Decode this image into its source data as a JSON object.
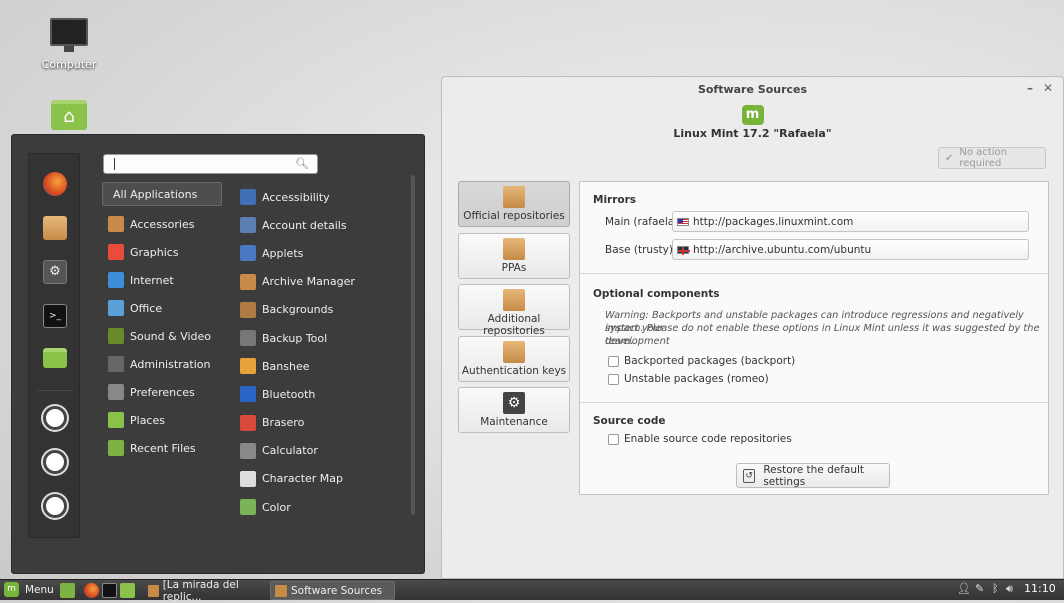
{
  "desktop": {
    "icons": [
      {
        "label": "Computer"
      },
      {
        "label": ""
      }
    ]
  },
  "menu": {
    "search_value": "",
    "categories": [
      {
        "label": "All Applications",
        "color": "#4e4e4e"
      },
      {
        "label": "Accessories",
        "color": "#c98b4a"
      },
      {
        "label": "Graphics",
        "color": "#e94c3c"
      },
      {
        "label": "Internet",
        "color": "#3c8ed6"
      },
      {
        "label": "Office",
        "color": "#5aa0d8"
      },
      {
        "label": "Sound & Video",
        "color": "#6a8a2a"
      },
      {
        "label": "Administration",
        "color": "#666666"
      },
      {
        "label": "Preferences",
        "color": "#888888"
      },
      {
        "label": "Places",
        "color": "#8bc34a"
      },
      {
        "label": "Recent Files",
        "color": "#7cb342"
      }
    ],
    "apps": [
      {
        "label": "Accessibility",
        "color": "#3f6fb5"
      },
      {
        "label": "Account details",
        "color": "#5b7fb0"
      },
      {
        "label": "Applets",
        "color": "#4a78c2"
      },
      {
        "label": "Archive Manager",
        "color": "#c98b4a"
      },
      {
        "label": "Backgrounds",
        "color": "#b07a46"
      },
      {
        "label": "Backup Tool",
        "color": "#777777"
      },
      {
        "label": "Banshee",
        "color": "#e8a23c"
      },
      {
        "label": "Bluetooth",
        "color": "#2a66c8"
      },
      {
        "label": "Brasero",
        "color": "#d94a3a"
      },
      {
        "label": "Calculator",
        "color": "#888888"
      },
      {
        "label": "Character Map",
        "color": "#dddddd"
      },
      {
        "label": "Color",
        "color": "#7ab35a"
      }
    ]
  },
  "window": {
    "title": "Software Sources",
    "brand": "Linux Mint 17.2 \"Rafaela\"",
    "no_action": "No action required",
    "tabs": [
      {
        "label": "Official repositories"
      },
      {
        "label": "PPAs"
      },
      {
        "label": "Additional repositories"
      },
      {
        "label": "Authentication keys"
      },
      {
        "label": "Maintenance"
      }
    ],
    "mirrors": {
      "title": "Mirrors",
      "main_label": "Main (rafaela)",
      "main_value": "http://packages.linuxmint.com",
      "base_label": "Base (trusty)",
      "base_value": "http://archive.ubuntu.com/ubuntu"
    },
    "optional": {
      "title": "Optional components",
      "warning_line1": "Warning: Backports and unstable packages can introduce regressions and negatively impact your",
      "warning_line2": "system. Please do not enable these options in Linux Mint unless it was suggested by the development",
      "warning_line3": "team.",
      "backport": "Backported packages (backport)",
      "unstable": "Unstable packages (romeo)"
    },
    "source": {
      "title": "Source code",
      "enable": "Enable source code repositories"
    },
    "restore": "Restore the default settings"
  },
  "panel": {
    "menu_label": "Menu",
    "tasks": [
      {
        "label": "[La mirada del replic..."
      },
      {
        "label": "Software Sources"
      }
    ],
    "clock": "11:10"
  }
}
